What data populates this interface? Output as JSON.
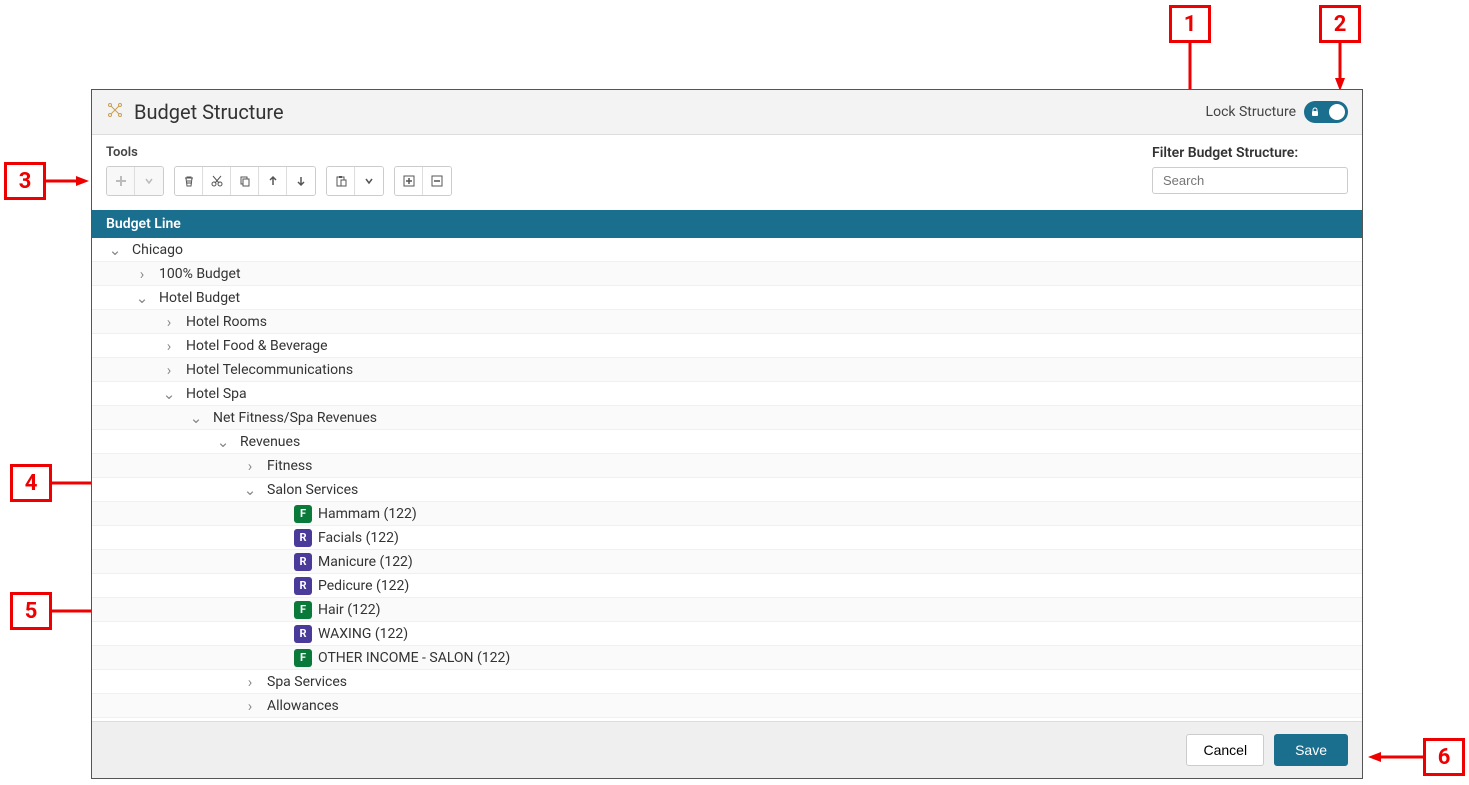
{
  "header": {
    "title": "Budget Structure",
    "lock_label": "Lock Structure"
  },
  "tools": {
    "label": "Tools"
  },
  "filter": {
    "label": "Filter Budget Structure:",
    "placeholder": "Search"
  },
  "table": {
    "header": "Budget Line"
  },
  "tree": [
    {
      "indent": 0,
      "toggle": "open",
      "label": "Chicago"
    },
    {
      "indent": 1,
      "toggle": "closed",
      "label": "100% Budget"
    },
    {
      "indent": 1,
      "toggle": "open",
      "label": "Hotel Budget"
    },
    {
      "indent": 2,
      "toggle": "closed",
      "label": "Hotel Rooms"
    },
    {
      "indent": 2,
      "toggle": "closed",
      "label": "Hotel Food & Beverage"
    },
    {
      "indent": 2,
      "toggle": "closed",
      "label": "Hotel Telecommunications"
    },
    {
      "indent": 2,
      "toggle": "open",
      "label": "Hotel Spa"
    },
    {
      "indent": 3,
      "toggle": "open",
      "label": "Net Fitness/Spa Revenues"
    },
    {
      "indent": 4,
      "toggle": "open",
      "label": "Revenues"
    },
    {
      "indent": 5,
      "toggle": "closed",
      "label": "Fitness"
    },
    {
      "indent": 5,
      "toggle": "open",
      "label": "Salon Services"
    },
    {
      "indent": 6,
      "toggle": null,
      "badge": "F",
      "label": "Hammam (122)"
    },
    {
      "indent": 6,
      "toggle": null,
      "badge": "R",
      "label": "Facials (122)"
    },
    {
      "indent": 6,
      "toggle": null,
      "badge": "R",
      "label": "Manicure (122)"
    },
    {
      "indent": 6,
      "toggle": null,
      "badge": "R",
      "label": "Pedicure (122)"
    },
    {
      "indent": 6,
      "toggle": null,
      "badge": "F",
      "label": "Hair (122)"
    },
    {
      "indent": 6,
      "toggle": null,
      "badge": "R",
      "label": "WAXING (122)"
    },
    {
      "indent": 6,
      "toggle": null,
      "badge": "F",
      "label": "OTHER INCOME - SALON (122)"
    },
    {
      "indent": 5,
      "toggle": "closed",
      "label": "Spa Services"
    },
    {
      "indent": 5,
      "toggle": "closed",
      "label": "Allowances"
    }
  ],
  "footer": {
    "cancel": "Cancel",
    "save": "Save"
  },
  "callouts": {
    "c1": "1",
    "c2": "2",
    "c3": "3",
    "c4": "4",
    "c5": "5",
    "c6": "6"
  }
}
